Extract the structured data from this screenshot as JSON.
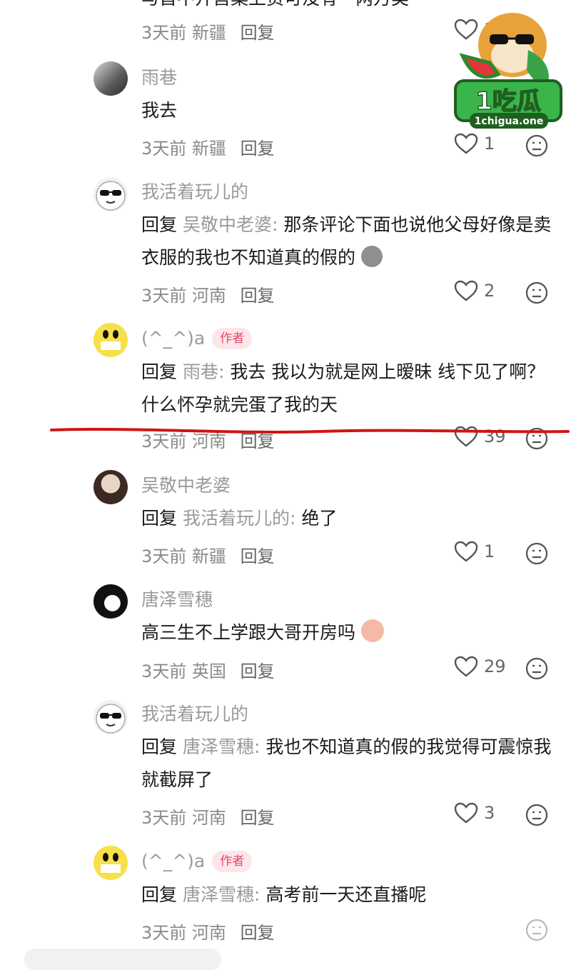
{
  "top": {
    "cut_text": "与首不开售案上资可没有一两万类",
    "time": "3天前",
    "location": "新疆",
    "reply_label": "回复",
    "likes": "18"
  },
  "comments": [
    {
      "nick": "雨巷",
      "reply_prefix": "",
      "reply_target": "",
      "text": "我去",
      "time": "3天前",
      "location": "新疆",
      "reply_label": "回复",
      "likes": "1"
    },
    {
      "nick": "我活着玩儿的",
      "reply_prefix": "回复",
      "reply_target": "吴敬中老婆:",
      "text": "那条评论下面也说他父母好像是卖衣服的我也不知道真的假的",
      "time": "3天前",
      "location": "河南",
      "reply_label": "回复",
      "likes": "2"
    },
    {
      "nick": "(^_^)a",
      "badge": "作者",
      "reply_prefix": "回复",
      "reply_target": "雨巷:",
      "text": "我去 我以为就是网上暧昧 线下见了啊？什么怀孕就完蛋了我的天",
      "time": "3天前",
      "location": "河南",
      "reply_label": "回复",
      "likes": "39"
    },
    {
      "nick": "吴敬中老婆",
      "reply_prefix": "回复",
      "reply_target": "我活着玩儿的:",
      "text": "绝了",
      "time": "3天前",
      "location": "新疆",
      "reply_label": "回复",
      "likes": "1"
    },
    {
      "nick": "唐泽雪穗",
      "reply_prefix": "",
      "reply_target": "",
      "text": "高三生不上学跟大哥开房吗",
      "time": "3天前",
      "location": "英国",
      "reply_label": "回复",
      "likes": "29"
    },
    {
      "nick": "我活着玩儿的",
      "reply_prefix": "回复",
      "reply_target": "唐泽雪穗:",
      "text": "我也不知道真的假的我觉得可震惊我就截屏了",
      "time": "3天前",
      "location": "河南",
      "reply_label": "回复",
      "likes": "3"
    },
    {
      "nick": "(^_^)a",
      "badge": "作者",
      "reply_prefix": "回复",
      "reply_target": "唐泽雪穗:",
      "text": "高考前一天还直播呢",
      "time": "3天前",
      "location": "河南",
      "reply_label": "回复",
      "likes": ""
    }
  ],
  "watermark": {
    "brand": "1吃瓜",
    "domain": "1chigua.one"
  },
  "colors": {
    "author_badge_bg": "#fde6e9",
    "author_badge_text": "#e8456a",
    "annotation_line": "#d01414"
  }
}
